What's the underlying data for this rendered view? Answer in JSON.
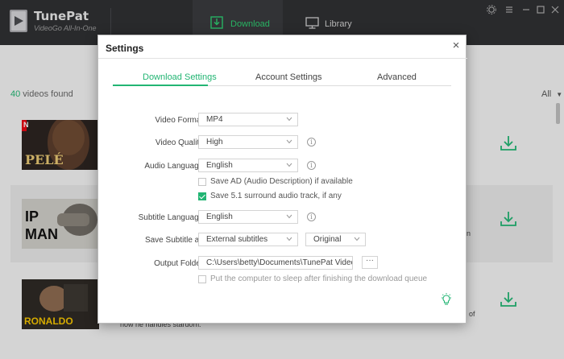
{
  "app": {
    "brand": "TunePat",
    "subtitle": "VideoGo All-In-One",
    "accent": "#22b573",
    "window_controls": [
      "gear-icon",
      "menu-icon",
      "minimize-icon",
      "maximize-icon",
      "close-icon"
    ]
  },
  "nav": {
    "download_label": "Download",
    "library_label": "Library"
  },
  "list": {
    "count_number": "40",
    "count_suffix": " videos found",
    "filter_label": "All",
    "rows": [
      {
        "thumb_text": "PELÉ",
        "badge": "N"
      },
      {
        "thumb_text_1": "IP",
        "thumb_text_2": "MAN",
        "side_text": "on"
      },
      {
        "thumb_text": "RONALDO",
        "side_text": "of",
        "desc_text": "how he handles stardom."
      }
    ]
  },
  "settings": {
    "title": "Settings",
    "tabs": [
      {
        "label": "Download Settings",
        "active": true
      },
      {
        "label": "Account Settings",
        "active": false
      },
      {
        "label": "Advanced",
        "active": false
      }
    ],
    "video_format": {
      "label": "Video Format:",
      "value": "MP4"
    },
    "video_quality": {
      "label": "Video Quality:",
      "value": "High"
    },
    "audio_language": {
      "label": "Audio Language:",
      "value": "English"
    },
    "save_ad": {
      "label": "Save AD (Audio Description) if available",
      "checked": false
    },
    "save_51": {
      "label": "Save 5.1 surround audio track, if any",
      "checked": true
    },
    "subtitle_language": {
      "label": "Subtitle Language:",
      "value": "English"
    },
    "save_subtitle": {
      "label": "Save Subtitle as:",
      "value": "External subtitles",
      "secondary_value": "Original"
    },
    "output_folder": {
      "label": "Output Folder:",
      "value": "C:\\Users\\betty\\Documents\\TunePat VideoGo",
      "browse_label": "···"
    },
    "sleep_option": {
      "label": "Put the computer to sleep after finishing the download queue",
      "checked": false
    }
  }
}
